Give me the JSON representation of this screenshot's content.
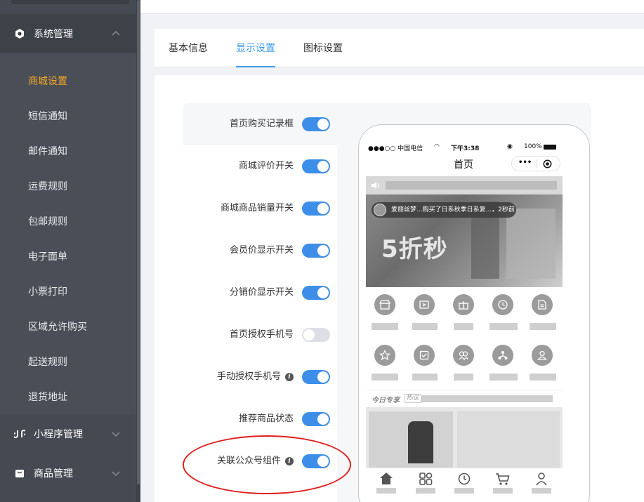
{
  "sidebar": {
    "groups": [
      {
        "label": "系统管理",
        "icon": "gear-icon"
      },
      {
        "label": "小程序管理",
        "icon": "mini-program-icon"
      },
      {
        "label": "商品管理",
        "icon": "goods-icon"
      }
    ],
    "items": [
      {
        "label": "商城设置",
        "selected": true
      },
      {
        "label": "短信通知"
      },
      {
        "label": "邮件通知"
      },
      {
        "label": "运费规则"
      },
      {
        "label": "包邮规则"
      },
      {
        "label": "电子面单"
      },
      {
        "label": "小票打印"
      },
      {
        "label": "区域允许购买"
      },
      {
        "label": "起送规则"
      },
      {
        "label": "退货地址"
      }
    ]
  },
  "tabs": [
    {
      "label": "基本信息"
    },
    {
      "label": "显示设置",
      "active": true
    },
    {
      "label": "图标设置"
    }
  ],
  "settings": [
    {
      "label": "首页购买记录框",
      "on": true
    },
    {
      "label": "商城评价开关",
      "on": true
    },
    {
      "label": "商城商品销量开关",
      "on": true
    },
    {
      "label": "会员价显示开关",
      "on": true
    },
    {
      "label": "分销价显示开关",
      "on": true
    },
    {
      "label": "首页授权手机号",
      "on": false
    },
    {
      "label": "手动授权手机号",
      "on": true,
      "info": true
    },
    {
      "label": "推荐商品状态",
      "on": true
    },
    {
      "label": "关联公众号组件",
      "on": true,
      "info": true
    }
  ],
  "phone": {
    "carrier": "●●●○○ 中国电信",
    "time": "下午3:38",
    "battery": "100%",
    "page_title": "首页",
    "capsule_more": "•••",
    "toast": "爱丽丝梦...购买了日系秋季日系复...，2秒前",
    "banner_text": "5折秒",
    "today_label": "今日专享",
    "hot_label": "热议"
  },
  "colors": {
    "accent": "#3d8ee8",
    "tab_active": "#3d9be9",
    "sidebar_selected": "#f5a623",
    "annotation": "#e02020"
  }
}
